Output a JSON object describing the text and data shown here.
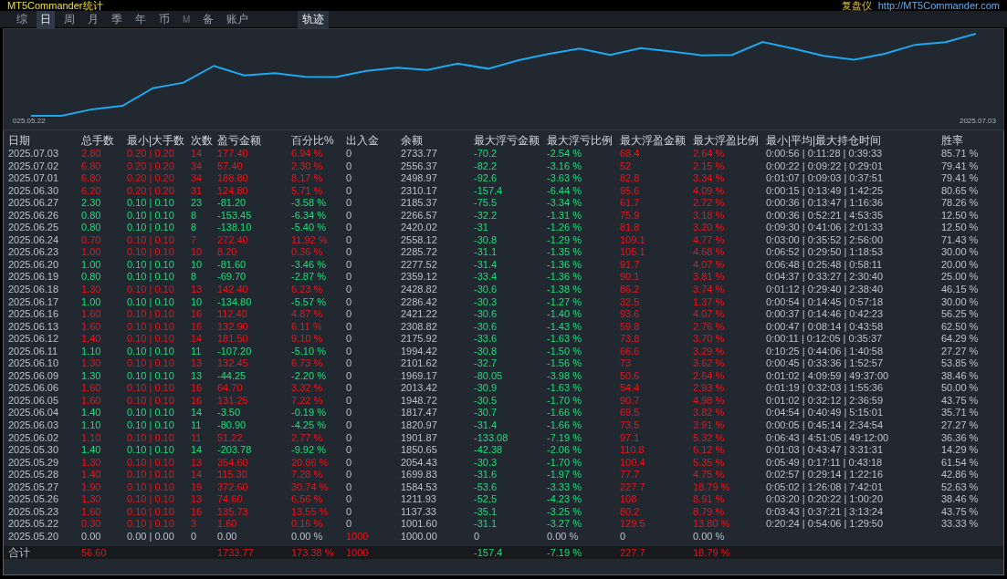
{
  "title_bar": {
    "app_title": "MT5Commander统计",
    "right_label": "复盘仪",
    "url": "http://MT5Commander.com"
  },
  "tabs": [
    {
      "label": "综",
      "selected": false,
      "disabled": false
    },
    {
      "label": "日",
      "selected": true,
      "disabled": false
    },
    {
      "label": "周",
      "selected": false,
      "disabled": false
    },
    {
      "label": "月",
      "selected": false,
      "disabled": false
    },
    {
      "label": "季",
      "selected": false,
      "disabled": false
    },
    {
      "label": "年",
      "selected": false,
      "disabled": false
    },
    {
      "label": "币",
      "selected": false,
      "disabled": false
    },
    {
      "label": "M",
      "selected": false,
      "disabled": true
    },
    {
      "label": "备",
      "selected": false,
      "disabled": false
    },
    {
      "label": "账户",
      "selected": false,
      "disabled": false
    }
  ],
  "track_button": "轨迹",
  "chart": {
    "start_label": "025.05.22",
    "end_label": "2025.07.03"
  },
  "table": {
    "columns": [
      "日期",
      "总手数",
      "最小|大手数",
      "次数",
      "盈亏金额",
      "百分比%",
      "出入金",
      "余额",
      "最大浮亏金额",
      "最大浮亏比例",
      "最大浮盈金额",
      "最大浮盈比例",
      "最小|平均|最大持仓时间",
      "胜率"
    ],
    "rows": [
      {
        "kind": "profit",
        "cells": [
          "2025.07.03",
          "2.80",
          "0.20 | 0.20",
          "14",
          "177.40",
          "6.94 %",
          "0",
          "2733.77",
          "-70.2",
          "-2.54 %",
          "68.4",
          "2.64 %",
          "0:00:56 | 0:11:28 | 0:39:33",
          "85.71 %"
        ]
      },
      {
        "kind": "profit",
        "cells": [
          "2025.07.02",
          "6.80",
          "0.20 | 0.20",
          "34",
          "57.40",
          "2.30 %",
          "0",
          "2556.37",
          "-82.2",
          "-3.16 %",
          "52",
          "2.15 %",
          "0:00:22 | 0:09:22 | 0:29:01",
          "79.41 %"
        ]
      },
      {
        "kind": "profit",
        "cells": [
          "2025.07.01",
          "6.80",
          "0.20 | 0.20",
          "34",
          "188.80",
          "8.17 %",
          "0",
          "2498.97",
          "-92.6",
          "-3.63 %",
          "82.8",
          "3.34 %",
          "0:01:07 | 0:09:03 | 0:37:51",
          "79.41 %"
        ]
      },
      {
        "kind": "profit",
        "cells": [
          "2025.06.30",
          "6.20",
          "0.20 | 0.20",
          "31",
          "124.80",
          "5.71 %",
          "0",
          "2310.17",
          "-157.4",
          "-6.44 %",
          "95.6",
          "4.09 %",
          "0:00:15 | 0:13:49 | 1:42:25",
          "80.65 %"
        ]
      },
      {
        "kind": "loss",
        "cells": [
          "2025.06.27",
          "2.30",
          "0.10 | 0.10",
          "23",
          "-81.20",
          "-3.58 %",
          "0",
          "2185.37",
          "-75.5",
          "-3.34 %",
          "61.7",
          "2.72 %",
          "0:00:36 | 0:13:47 | 1:16:36",
          "78.26 %"
        ]
      },
      {
        "kind": "loss",
        "cells": [
          "2025.06.26",
          "0.80",
          "0.10 | 0.10",
          "8",
          "-153.45",
          "-6.34 %",
          "0",
          "2266.57",
          "-32.2",
          "-1.31 %",
          "75.9",
          "3.18 %",
          "0:00:36 | 0:52:21 | 4:53:35",
          "12.50 %"
        ]
      },
      {
        "kind": "loss",
        "cells": [
          "2025.06.25",
          "0.80",
          "0.10 | 0.10",
          "8",
          "-138.10",
          "-5.40 %",
          "0",
          "2420.02",
          "-31",
          "-1.26 %",
          "81.8",
          "3.20 %",
          "0:09:30 | 0:41:06 | 2:01:33",
          "12.50 %"
        ]
      },
      {
        "kind": "profit",
        "cells": [
          "2025.06.24",
          "0.70",
          "0.10 | 0.10",
          "7",
          "272.40",
          "11.92 %",
          "0",
          "2558.12",
          "-30.8",
          "-1.29 %",
          "109.1",
          "4.77 %",
          "0:03:00 | 0:35:52 | 2:56:00",
          "71.43 %"
        ]
      },
      {
        "kind": "profit",
        "cells": [
          "2025.06.23",
          "1.00",
          "0.10 | 0.10",
          "10",
          "8.20",
          "0.36 %",
          "0",
          "2285.72",
          "-31.1",
          "-1.35 %",
          "105.1",
          "4.68 %",
          "0:06:52 | 0:29:50 | 1:18:53",
          "30.00 %"
        ]
      },
      {
        "kind": "loss",
        "cells": [
          "2025.06.20",
          "1.00",
          "0.10 | 0.10",
          "10",
          "-81.60",
          "-3.46 %",
          "0",
          "2277.52",
          "-31.4",
          "-1.36 %",
          "91.7",
          "4.07 %",
          "0:06:48 | 0:25:48 | 0:58:11",
          "20.00 %"
        ]
      },
      {
        "kind": "loss",
        "cells": [
          "2025.06.19",
          "0.80",
          "0.10 | 0.10",
          "8",
          "-69.70",
          "-2.87 %",
          "0",
          "2359.12",
          "-33.4",
          "-1.36 %",
          "90.1",
          "3.81 %",
          "0:04:37 | 0:33:27 | 2:30:40",
          "25.00 %"
        ]
      },
      {
        "kind": "profit",
        "cells": [
          "2025.06.18",
          "1.30",
          "0.10 | 0.10",
          "13",
          "142.40",
          "6.23 %",
          "0",
          "2428.82",
          "-30.6",
          "-1.38 %",
          "86.2",
          "3.74 %",
          "0:01:12 | 0:29:40 | 2:38:40",
          "46.15 %"
        ]
      },
      {
        "kind": "loss",
        "cells": [
          "2025.06.17",
          "1.00",
          "0.10 | 0.10",
          "10",
          "-134.80",
          "-5.57 %",
          "0",
          "2286.42",
          "-30.3",
          "-1.27 %",
          "32.5",
          "1.37 %",
          "0:00:54 | 0:14:45 | 0:57:18",
          "30.00 %"
        ]
      },
      {
        "kind": "profit",
        "cells": [
          "2025.06.16",
          "1.60",
          "0.10 | 0.10",
          "16",
          "112.40",
          "4.87 %",
          "0",
          "2421.22",
          "-30.6",
          "-1.40 %",
          "93.6",
          "4.07 %",
          "0:00:37 | 0:14:46 | 0:42:23",
          "56.25 %"
        ]
      },
      {
        "kind": "profit",
        "cells": [
          "2025.06.13",
          "1.60",
          "0.10 | 0.10",
          "16",
          "132.90",
          "6.11 %",
          "0",
          "2308.82",
          "-30.6",
          "-1.43 %",
          "59.8",
          "2.76 %",
          "0:00:47 | 0:08:14 | 0:43:58",
          "62.50 %"
        ]
      },
      {
        "kind": "profit",
        "cells": [
          "2025.06.12",
          "1.40",
          "0.10 | 0.10",
          "14",
          "181.50",
          "9.10 %",
          "0",
          "2175.92",
          "-33.6",
          "-1.63 %",
          "73.8",
          "3.70 %",
          "0:00:11 | 0:12:05 | 0:35:37",
          "64.29 %"
        ]
      },
      {
        "kind": "loss",
        "cells": [
          "2025.06.11",
          "1.10",
          "0.10 | 0.10",
          "11",
          "-107.20",
          "-5.10 %",
          "0",
          "1994.42",
          "-30.8",
          "-1.50 %",
          "66.6",
          "3.29 %",
          "0:10:25 | 0:44:06 | 1:40:58",
          "27.27 %"
        ]
      },
      {
        "kind": "profit",
        "cells": [
          "2025.06.10",
          "1.30",
          "0.10 | 0.10",
          "13",
          "132.45",
          "6.73 %",
          "0",
          "2101.62",
          "-32.7",
          "-1.56 %",
          "73",
          "3.62 %",
          "0:00:45 | 0:33:36 | 1:52:57",
          "53.85 %"
        ]
      },
      {
        "kind": "loss",
        "cells": [
          "2025.06.09",
          "1.30",
          "0.10 | 0.10",
          "13",
          "-44.25",
          "-2.20 %",
          "0",
          "1969.17",
          "-80.05",
          "-3.98 %",
          "50.6",
          "2.64 %",
          "0:01:02 | 4:09:59 | 49:37:00",
          "38.46 %"
        ]
      },
      {
        "kind": "profit",
        "cells": [
          "2025.06.06",
          "1.60",
          "0.10 | 0.10",
          "16",
          "64.70",
          "3.32 %",
          "0",
          "2013.42",
          "-30.9",
          "-1.63 %",
          "54.4",
          "2.93 %",
          "0:01:19 | 0:32:03 | 1:55:36",
          "50.00 %"
        ]
      },
      {
        "kind": "profit",
        "cells": [
          "2025.06.05",
          "1.60",
          "0.10 | 0.10",
          "16",
          "131.25",
          "7.22 %",
          "0",
          "1948.72",
          "-30.5",
          "-1.70 %",
          "90.7",
          "4.98 %",
          "0:01:02 | 0:32:12 | 2:36:59",
          "43.75 %"
        ]
      },
      {
        "kind": "loss",
        "cells": [
          "2025.06.04",
          "1.40",
          "0.10 | 0.10",
          "14",
          "-3.50",
          "-0.19 %",
          "0",
          "1817.47",
          "-30.7",
          "-1.66 %",
          "69.5",
          "3.82 %",
          "0:04:54 | 0:40:49 | 5:15:01",
          "35.71 %"
        ]
      },
      {
        "kind": "loss",
        "cells": [
          "2025.06.03",
          "1.10",
          "0.10 | 0.10",
          "11",
          "-80.90",
          "-4.25 %",
          "0",
          "1820.97",
          "-31.4",
          "-1.66 %",
          "73.5",
          "3.91 %",
          "0:00:05 | 0:45:14 | 2:34:54",
          "27.27 %"
        ]
      },
      {
        "kind": "profit",
        "cells": [
          "2025.06.02",
          "1.10",
          "0.10 | 0.10",
          "11",
          "51.22",
          "2.77 %",
          "0",
          "1901.87",
          "-133.08",
          "-7.19 %",
          "97.1",
          "5.32 %",
          "0:06:43 | 4:51:05 | 49:12:00",
          "36.36 %"
        ]
      },
      {
        "kind": "loss",
        "cells": [
          "2025.05.30",
          "1.40",
          "0.10 | 0.10",
          "14",
          "-203.78",
          "-9.92 %",
          "0",
          "1850.65",
          "-42.38",
          "-2.06 %",
          "110.8",
          "6.12 %",
          "0:01:03 | 0:43:47 | 3:31:31",
          "14.29 %"
        ]
      },
      {
        "kind": "profit",
        "cells": [
          "2025.05.29",
          "1.30",
          "0.10 | 0.10",
          "13",
          "354.60",
          "20.86 %",
          "0",
          "2054.43",
          "-30.3",
          "-1.70 %",
          "100.4",
          "5.35 %",
          "0:05:49 | 0:17:11 | 0:43:18",
          "61.54 %"
        ]
      },
      {
        "kind": "profit",
        "cells": [
          "2025.05.28",
          "1.40",
          "0.10 | 0.10",
          "14",
          "115.30",
          "7.28 %",
          "0",
          "1699.83",
          "-31.6",
          "-1.97 %",
          "77.7",
          "4.75 %",
          "0:02:57 | 0:29:14 | 1:22:16",
          "42.86 %"
        ]
      },
      {
        "kind": "profit",
        "cells": [
          "2025.05.27",
          "1.90",
          "0.10 | 0.10",
          "19",
          "372.60",
          "30.74 %",
          "0",
          "1584.53",
          "-53.6",
          "-3.33 %",
          "227.7",
          "18.79 %",
          "0:05:02 | 1:26:08 | 7:42:01",
          "52.63 %"
        ]
      },
      {
        "kind": "profit",
        "cells": [
          "2025.05.26",
          "1.30",
          "0.10 | 0.10",
          "13",
          "74.60",
          "6.56 %",
          "0",
          "1211.93",
          "-52.5",
          "-4.23 %",
          "108",
          "8.91 %",
          "0:03:20 | 0:20:22 | 1:00:20",
          "38.46 %"
        ]
      },
      {
        "kind": "profit",
        "cells": [
          "2025.05.23",
          "1.60",
          "0.10 | 0.10",
          "16",
          "135.73",
          "13.55 %",
          "0",
          "1137.33",
          "-35.1",
          "-3.25 %",
          "80.2",
          "8.79 %",
          "0:03:43 | 0:37:21 | 3:13:24",
          "43.75 %"
        ]
      },
      {
        "kind": "profit",
        "cells": [
          "2025.05.22",
          "0.30",
          "0.10 | 0.10",
          "3",
          "1.60",
          "0.16 %",
          "0",
          "1001.60",
          "-31.1",
          "-3.27 %",
          "129.5",
          "13.80 %",
          "0:20:24 | 0:54:06 | 1:29:50",
          "33.33 %"
        ]
      },
      {
        "kind": "deposit",
        "cells": [
          "2025.05.20",
          "0.00",
          "0.00 | 0.00",
          "0",
          "0.00",
          "0.00 %",
          "1000",
          "1000.00",
          "0",
          "0.00 %",
          "0",
          "0.00 %"
        ]
      }
    ],
    "total": {
      "label": "合计",
      "lots": "56.60",
      "profit": "1733.77",
      "percent": "173.38 %",
      "deposit": "1000",
      "max_float_loss": "-157.4",
      "max_float_loss_pct": "-7.19 %",
      "max_float_profit": "227.7",
      "max_float_profit_pct": "18.79 %"
    }
  }
}
